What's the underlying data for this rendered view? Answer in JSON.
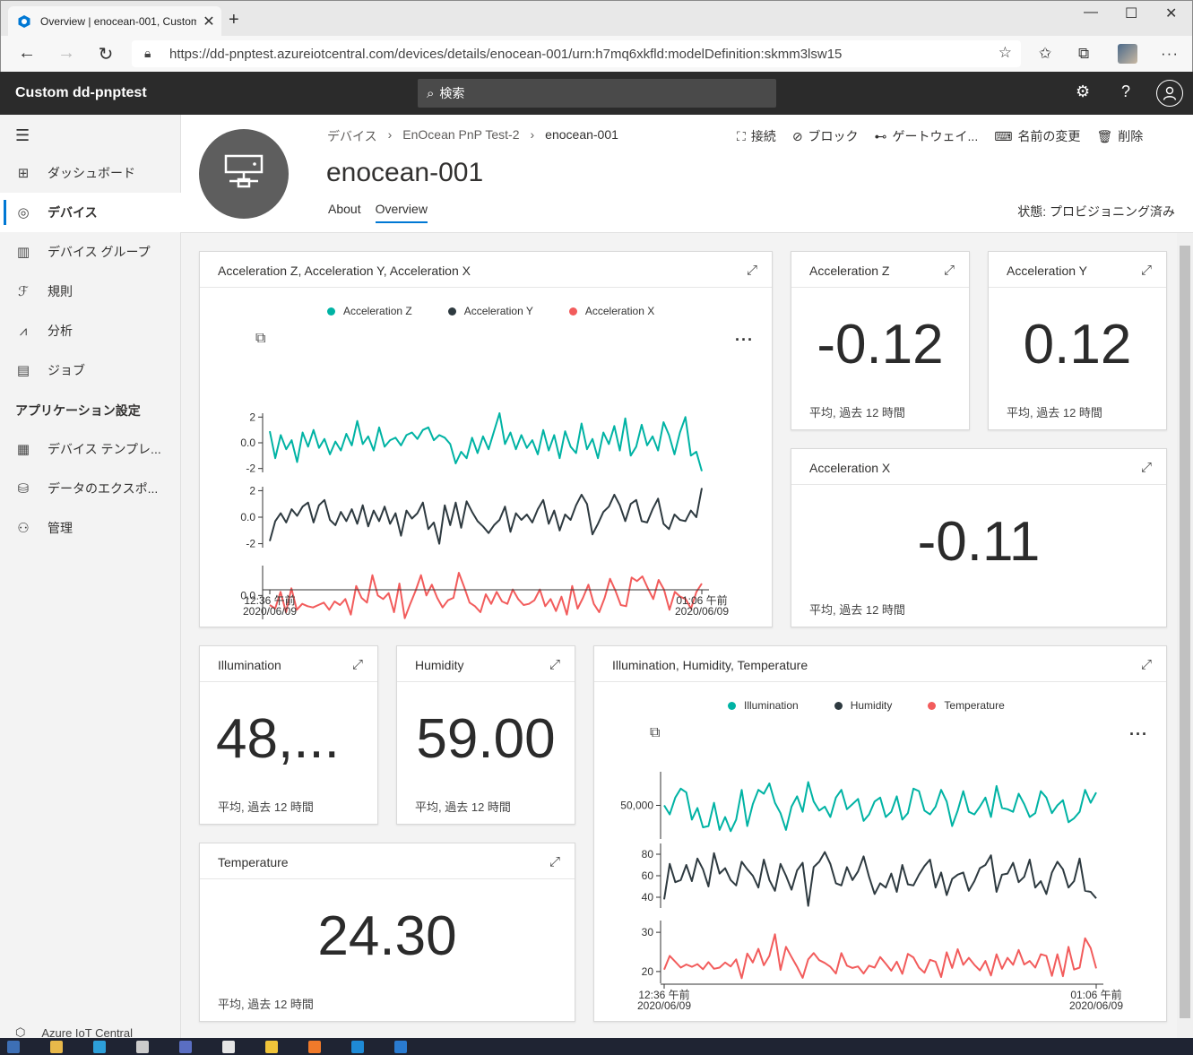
{
  "browser": {
    "tab_title": "Overview | enocean-001, Custom",
    "url": "https://dd-pnptest.azureiotcentral.com/devices/details/enocean-001/urn:h7mq6xkfld:modelDefinition:skmm3lsw15"
  },
  "app": {
    "name": "Custom dd-pnptest",
    "search_placeholder": "検索"
  },
  "sidebar": {
    "items": [
      {
        "label": "ダッシュボード",
        "icon": "dashboard-icon"
      },
      {
        "label": "デバイス",
        "icon": "devices-icon"
      },
      {
        "label": "デバイス グループ",
        "icon": "device-groups-icon"
      },
      {
        "label": "規則",
        "icon": "rules-icon"
      },
      {
        "label": "分析",
        "icon": "analytics-icon"
      },
      {
        "label": "ジョブ",
        "icon": "jobs-icon"
      }
    ],
    "section": "アプリケーション設定",
    "settings_items": [
      {
        "label": "デバイス テンプレ...",
        "icon": "device-templates-icon"
      },
      {
        "label": "データのエクスポ...",
        "icon": "data-export-icon"
      },
      {
        "label": "管理",
        "icon": "administration-icon"
      }
    ],
    "footer": "Azure IoT Central"
  },
  "device": {
    "breadcrumb": [
      "デバイス",
      "EnOcean PnP Test-2",
      "enocean-001"
    ],
    "title": "enocean-001",
    "tabs": [
      "About",
      "Overview"
    ],
    "active_tab": "Overview",
    "status": "状態: プロビジョニング済み",
    "commands": [
      {
        "label": "接続",
        "icon": "connect-icon"
      },
      {
        "label": "ブロック",
        "icon": "block-icon"
      },
      {
        "label": "ゲートウェイ...",
        "icon": "gateway-icon"
      },
      {
        "label": "名前の変更",
        "icon": "rename-icon"
      },
      {
        "label": "削除",
        "icon": "delete-icon"
      }
    ]
  },
  "tiles": {
    "accel_chart_title": "Acceleration Z, Acceleration Y, Acceleration X",
    "env_chart_title": "Illumination, Humidity, Temperature",
    "footer": "平均, 過去 12 時間",
    "kpis": {
      "accel_z": {
        "title": "Acceleration Z",
        "value": "-0.12"
      },
      "accel_y": {
        "title": "Acceleration Y",
        "value": "0.12"
      },
      "accel_x": {
        "title": "Acceleration X",
        "value": "-0.11"
      },
      "illumination": {
        "title": "Illumination",
        "value": "48,..."
      },
      "humidity": {
        "title": "Humidity",
        "value": "59.00"
      },
      "temperature": {
        "title": "Temperature",
        "value": "24.30"
      }
    }
  },
  "colors": {
    "teal": "#00b3a4",
    "dark": "#2e3a40",
    "red": "#f25c5c",
    "accent": "#0078d4"
  },
  "chart_data": [
    {
      "type": "line",
      "x_start": "12:36 午前 2020/06/09",
      "x_end": "01:06 午前 2020/06/09",
      "series": [
        {
          "name": "Acceleration Z",
          "color": "#00b3a4",
          "yticks": [
            "2",
            "0.0",
            "-2"
          ],
          "ylim": [
            -2.3,
            2.3
          ],
          "values": [
            0.9,
            -1.2,
            0.6,
            -0.5,
            0.2,
            -1.5,
            0.8,
            -0.3,
            1.0,
            -0.4,
            0.3,
            -0.9,
            0.1,
            -0.6,
            0.7,
            -0.2,
            1.7,
            -0.1,
            0.5,
            -0.6,
            1.2,
            -0.3,
            0.2,
            0.4,
            -0.2,
            0.6,
            0.8,
            0.3,
            1.0,
            1.2,
            0.2,
            0.6,
            0.4,
            -0.1,
            -1.6,
            -0.7,
            -1.2,
            0.4,
            -0.8,
            0.5,
            -0.5,
            0.9,
            2.3,
            -0.1,
            0.8,
            -0.5,
            0.6,
            -0.4,
            0.2,
            -0.9,
            1.0,
            -0.6,
            0.6,
            -1.2,
            0.9,
            -0.3,
            -0.8,
            1.5,
            -0.5,
            0.3,
            -1.2,
            0.8,
            -0.1,
            1.3,
            -0.6,
            1.9,
            -1.0,
            -0.3,
            1.4,
            -0.2,
            0.5,
            -0.6,
            1.6,
            0.6,
            -0.9,
            0.8,
            2.0,
            -1.0,
            -0.7,
            -2.2
          ]
        },
        {
          "name": "Acceleration Y",
          "color": "#2e3a40",
          "yticks": [
            "2",
            "0.0",
            "-2"
          ],
          "ylim": [
            -2.3,
            2.3
          ],
          "values": [
            -1.8,
            -0.3,
            0.3,
            -0.4,
            0.6,
            0.1,
            0.8,
            1.1,
            -0.4,
            0.9,
            1.3,
            -0.2,
            -0.6,
            0.4,
            -0.3,
            0.6,
            -0.5,
            0.9,
            -0.7,
            0.5,
            -0.3,
            0.8,
            -0.5,
            0.3,
            -1.4,
            0.5,
            -0.1,
            0.3,
            1.1,
            -0.9,
            -0.4,
            -2.0,
            0.9,
            -0.6,
            1.1,
            -0.8,
            1.2,
            0.4,
            -0.3,
            -0.7,
            -1.2,
            -0.6,
            -0.2,
            0.8,
            -1.1,
            0.3,
            -0.2,
            0.2,
            -0.4,
            0.6,
            1.3,
            -0.5,
            0.5,
            -1.0,
            0.2,
            -0.2,
            0.9,
            1.7,
            1.0,
            -1.3,
            -0.5,
            0.4,
            0.8,
            1.7,
            0.9,
            -0.3,
            1.0,
            1.3,
            -0.3,
            -0.4,
            0.6,
            1.4,
            -0.5,
            -0.9,
            0.2,
            -0.2,
            -0.3,
            0.5,
            0.0,
            2.2
          ]
        },
        {
          "name": "Acceleration X",
          "color": "#f25c5c",
          "yticks": [
            "0.0"
          ],
          "ylim": [
            -2.0,
            2.5
          ],
          "values": [
            -0.8,
            -1.1,
            0.3,
            -1.4,
            0.6,
            -1.2,
            -0.7,
            -0.9,
            -1.0,
            -0.8,
            -0.6,
            -1.2,
            -0.5,
            -0.8,
            -0.3,
            -1.6,
            0.8,
            -0.2,
            -0.6,
            1.7,
            0.0,
            -0.3,
            0.2,
            -1.4,
            1.0,
            -1.9,
            -0.7,
            0.4,
            1.7,
            0.0,
            0.9,
            -0.2,
            -1.0,
            -0.4,
            -0.2,
            1.9,
            0.7,
            -0.6,
            -0.9,
            -1.4,
            0.1,
            -0.7,
            0.3,
            -0.5,
            -0.7,
            0.5,
            -0.3,
            -0.8,
            -0.7,
            -0.4,
            0.5,
            -0.9,
            -0.3,
            -1.3,
            -0.1,
            -1.6,
            0.8,
            -1.1,
            -0.2,
            0.9,
            -0.7,
            -1.4,
            -0.2,
            1.4,
            0.4,
            -0.8,
            -0.9,
            1.5,
            1.2,
            1.6,
            0.6,
            -0.3,
            1.3,
            0.5,
            -1.2,
            0.3,
            -0.1,
            -0.3,
            -1.1,
            0.3,
            1.0
          ]
        }
      ]
    },
    {
      "type": "line",
      "x_start": "12:36 午前 2020/06/09",
      "x_end": "01:06 午前 2020/06/09",
      "series": [
        {
          "name": "Illumination",
          "color": "#00b3a4",
          "yticks": [
            "50,000"
          ],
          "ylim": [
            37000,
            63000
          ],
          "values": [
            50000,
            46500,
            53000,
            56500,
            55000,
            44500,
            49000,
            41500,
            42000,
            51000,
            40500,
            45500,
            40000,
            44500,
            56000,
            42000,
            50500,
            56000,
            54500,
            58500,
            51000,
            47000,
            40500,
            49500,
            53500,
            47500,
            59000,
            51500,
            48000,
            49500,
            45500,
            53000,
            56000,
            48500,
            50500,
            52500,
            44000,
            46500,
            51500,
            53000,
            45500,
            47500,
            53500,
            44500,
            47000,
            56500,
            55500,
            48000,
            46500,
            49500,
            56000,
            51500,
            42000,
            48000,
            55500,
            47500,
            46500,
            49500,
            53000,
            45500,
            57500,
            49000,
            48500,
            47500,
            54500,
            50500,
            45500,
            47000,
            55500,
            53000,
            47000,
            50000,
            52000,
            43500,
            45000,
            47500,
            56000,
            51000,
            55000
          ]
        },
        {
          "name": "Humidity",
          "color": "#2e3a40",
          "yticks": [
            "80",
            "60",
            "40"
          ],
          "ylim": [
            30,
            90
          ],
          "values": [
            38,
            71,
            54,
            56,
            70,
            55,
            76,
            66,
            50,
            81,
            62,
            67,
            56,
            51,
            73,
            66,
            60,
            49,
            75,
            56,
            46,
            71,
            60,
            47,
            65,
            72,
            32,
            68,
            73,
            82,
            71,
            53,
            51,
            68,
            56,
            64,
            78,
            59,
            43,
            53,
            49,
            62,
            45,
            70,
            52,
            51,
            61,
            69,
            75,
            49,
            63,
            42,
            57,
            61,
            63,
            46,
            55,
            67,
            70,
            79,
            45,
            61,
            62,
            72,
            54,
            59,
            75,
            49,
            55,
            43,
            63,
            73,
            66,
            49,
            55,
            76,
            46,
            45,
            39
          ]
        },
        {
          "name": "Temperature",
          "color": "#f25c5c",
          "yticks": [
            "30",
            "20"
          ],
          "ylim": [
            17,
            33
          ],
          "values": [
            20.5,
            24.0,
            22.5,
            21.0,
            21.8,
            21.2,
            21.9,
            20.6,
            22.4,
            20.7,
            21.0,
            22.3,
            21.3,
            23.1,
            18.3,
            24.6,
            22.3,
            25.8,
            21.6,
            24.0,
            29.5,
            20.4,
            26.3,
            23.7,
            21.2,
            18.4,
            23.1,
            24.7,
            22.9,
            22.2,
            21.2,
            19.5,
            24.7,
            21.5,
            20.9,
            21.3,
            19.5,
            21.5,
            21.0,
            23.7,
            22.0,
            20.2,
            22.5,
            19.4,
            24.5,
            23.6,
            21.0,
            19.7,
            23.0,
            22.5,
            18.6,
            24.9,
            20.9,
            25.7,
            21.7,
            23.5,
            21.7,
            20.3,
            22.7,
            19.0,
            24.4,
            20.7,
            23.5,
            21.7,
            25.5,
            21.8,
            22.7,
            21.0,
            24.4,
            24.0,
            18.9,
            24.4,
            18.8,
            26.3,
            20.5,
            21.0,
            28.5,
            26.0,
            20.8
          ]
        }
      ]
    }
  ]
}
